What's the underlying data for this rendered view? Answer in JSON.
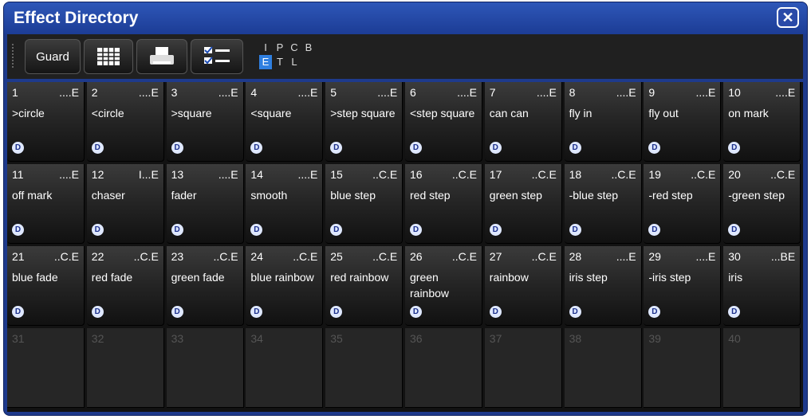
{
  "window": {
    "title": "Effect Directory",
    "close_icon": "close-x-icon"
  },
  "toolbar": {
    "guard_label": "Guard",
    "buttons": [
      "grid-view-icon",
      "printer-icon",
      "checklist-icon"
    ],
    "filters_row1": [
      "I",
      "P",
      "C",
      "B"
    ],
    "filters_row2": [
      "E",
      "T",
      "L"
    ],
    "selected_filter": "E"
  },
  "effects": [
    {
      "num": "1",
      "flags": "....E",
      "label": ">circle",
      "badge": "D"
    },
    {
      "num": "2",
      "flags": "....E",
      "label": "<circle",
      "badge": "D"
    },
    {
      "num": "3",
      "flags": "....E",
      "label": ">square",
      "badge": "D"
    },
    {
      "num": "4",
      "flags": "....E",
      "label": "<square",
      "badge": "D"
    },
    {
      "num": "5",
      "flags": "....E",
      "label": ">step square",
      "badge": "D"
    },
    {
      "num": "6",
      "flags": "....E",
      "label": "<step square",
      "badge": "D"
    },
    {
      "num": "7",
      "flags": "....E",
      "label": "can can",
      "badge": "D"
    },
    {
      "num": "8",
      "flags": "....E",
      "label": "fly in",
      "badge": "D"
    },
    {
      "num": "9",
      "flags": "....E",
      "label": "fly out",
      "badge": "D"
    },
    {
      "num": "10",
      "flags": "....E",
      "label": "on mark",
      "badge": "D"
    },
    {
      "num": "11",
      "flags": "....E",
      "label": "off mark",
      "badge": "D"
    },
    {
      "num": "12",
      "flags": "I...E",
      "label": "chaser",
      "badge": "D"
    },
    {
      "num": "13",
      "flags": "....E",
      "label": "fader",
      "badge": "D"
    },
    {
      "num": "14",
      "flags": "....E",
      "label": "smooth",
      "badge": "D"
    },
    {
      "num": "15",
      "flags": "..C.E",
      "label": "blue step",
      "badge": "D"
    },
    {
      "num": "16",
      "flags": "..C.E",
      "label": "red step",
      "badge": "D"
    },
    {
      "num": "17",
      "flags": "..C.E",
      "label": "green step",
      "badge": "D"
    },
    {
      "num": "18",
      "flags": "..C.E",
      "label": "-blue step",
      "badge": "D"
    },
    {
      "num": "19",
      "flags": "..C.E",
      "label": "-red step",
      "badge": "D"
    },
    {
      "num": "20",
      "flags": "..C.E",
      "label": "-green step",
      "badge": "D"
    },
    {
      "num": "21",
      "flags": "..C.E",
      "label": "blue fade",
      "badge": "D"
    },
    {
      "num": "22",
      "flags": "..C.E",
      "label": "red fade",
      "badge": "D"
    },
    {
      "num": "23",
      "flags": "..C.E",
      "label": "green fade",
      "badge": "D"
    },
    {
      "num": "24",
      "flags": "..C.E",
      "label": "blue rainbow",
      "badge": "D"
    },
    {
      "num": "25",
      "flags": "..C.E",
      "label": "red rainbow",
      "badge": "D"
    },
    {
      "num": "26",
      "flags": "..C.E",
      "label": "green rainbow",
      "badge": "D"
    },
    {
      "num": "27",
      "flags": "..C.E",
      "label": "rainbow",
      "badge": "D"
    },
    {
      "num": "28",
      "flags": "....E",
      "label": "iris step",
      "badge": "D"
    },
    {
      "num": "29",
      "flags": "....E",
      "label": "-iris step",
      "badge": "D"
    },
    {
      "num": "30",
      "flags": "...BE",
      "label": "iris",
      "badge": "D"
    },
    {
      "num": "31",
      "flags": "",
      "label": "",
      "badge": ""
    },
    {
      "num": "32",
      "flags": "",
      "label": "",
      "badge": ""
    },
    {
      "num": "33",
      "flags": "",
      "label": "",
      "badge": ""
    },
    {
      "num": "34",
      "flags": "",
      "label": "",
      "badge": ""
    },
    {
      "num": "35",
      "flags": "",
      "label": "",
      "badge": ""
    },
    {
      "num": "36",
      "flags": "",
      "label": "",
      "badge": ""
    },
    {
      "num": "37",
      "flags": "",
      "label": "",
      "badge": ""
    },
    {
      "num": "38",
      "flags": "",
      "label": "",
      "badge": ""
    },
    {
      "num": "39",
      "flags": "",
      "label": "",
      "badge": ""
    },
    {
      "num": "40",
      "flags": "",
      "label": "",
      "badge": ""
    }
  ]
}
